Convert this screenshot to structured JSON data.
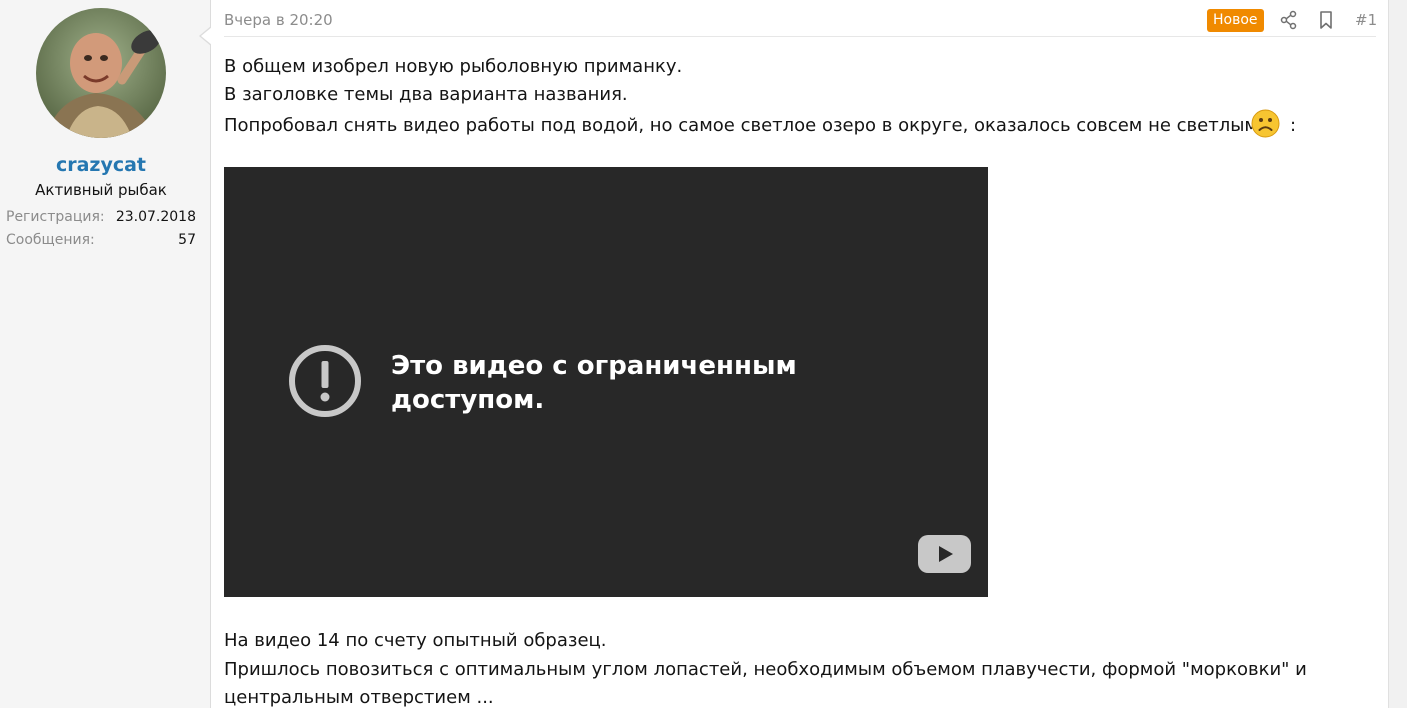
{
  "user": {
    "username": "crazycat",
    "title": "Активный рыбак",
    "stats": [
      {
        "label": "Регистрация:",
        "value": "23.07.2018"
      },
      {
        "label": "Сообщения:",
        "value": "57"
      }
    ]
  },
  "post": {
    "date": "Вчера в 20:20",
    "badge": "Новое",
    "number": "#1",
    "lines": [
      "В общем изобрел новую рыболовную приманку.",
      "В заголовке темы два варианта названия.",
      "Попробовал снять видео работы под водой, но самое светлое озеро в округе, оказалось совсем не светлым"
    ],
    "line3_suffix": ":",
    "emoji": "sad-face",
    "video": {
      "message": "Это видео с ограниченным доступом."
    },
    "after_video": [
      "На видео 14 по счету опытный образец.",
      "Пришлось повозиться с оптимальным углом лопастей, необходимым объемом плавучести, формой \"морковки\" и",
      "центральным отверстием ..."
    ]
  },
  "colors": {
    "accent": "#2577b1",
    "badge": "#f08a00",
    "video_bg": "#282828"
  }
}
